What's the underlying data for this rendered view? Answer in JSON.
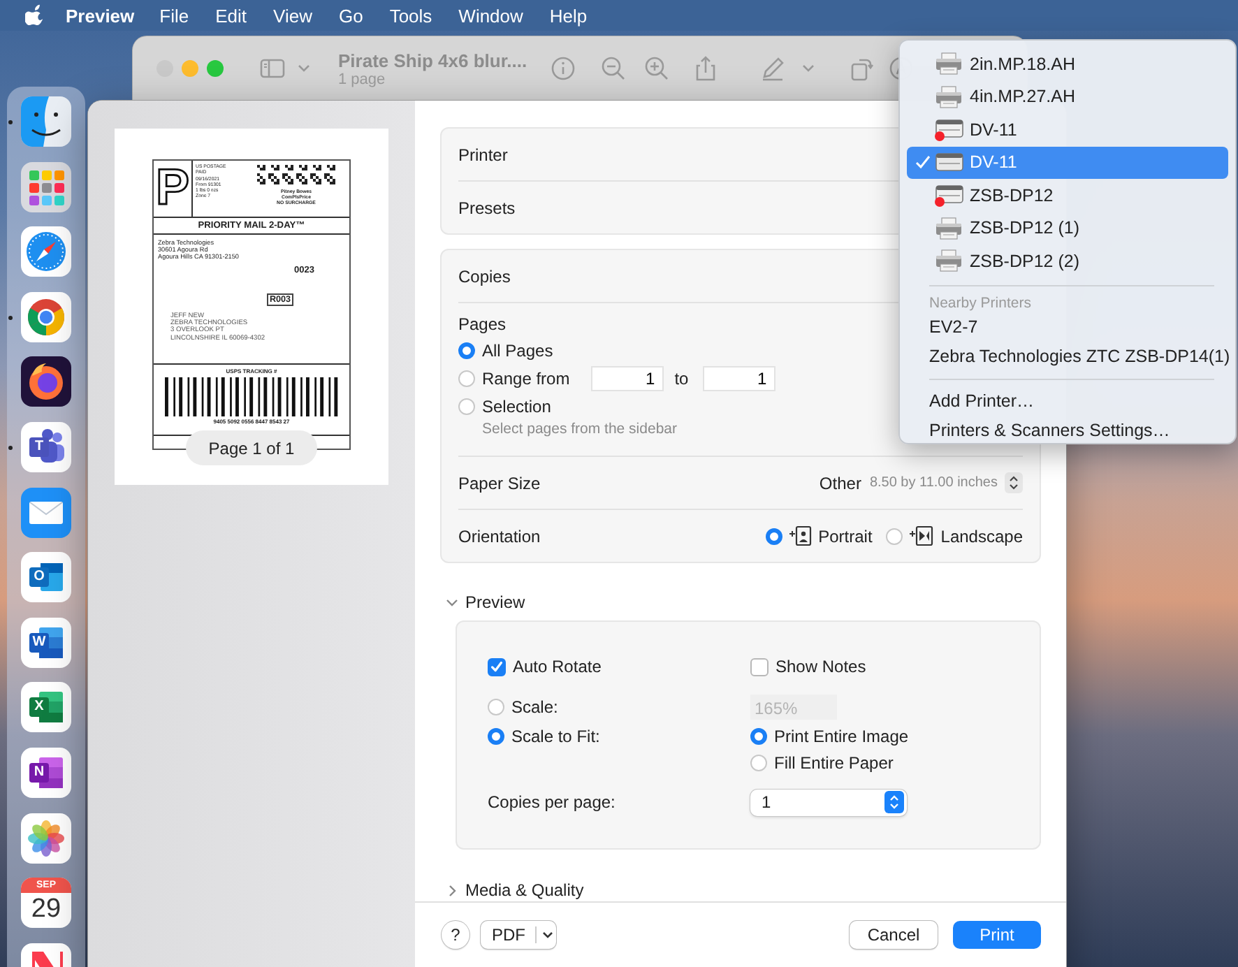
{
  "menubar": {
    "app": "Preview",
    "items": [
      "File",
      "Edit",
      "View",
      "Go",
      "Tools",
      "Window",
      "Help"
    ]
  },
  "preview_window": {
    "title": "Pirate Ship 4x6 blur....",
    "subtitle": "1 page"
  },
  "dock": {
    "apps": [
      {
        "kind": "finder",
        "running": true
      },
      {
        "kind": "launchpad",
        "running": false
      },
      {
        "kind": "safari",
        "running": false
      },
      {
        "kind": "chrome",
        "running": true
      },
      {
        "kind": "firefox",
        "running": false
      },
      {
        "kind": "teams",
        "running": true,
        "letter": "T"
      },
      {
        "kind": "mail",
        "running": false
      },
      {
        "kind": "outlook",
        "running": false,
        "letter": "O"
      },
      {
        "kind": "word",
        "running": false,
        "letter": "W"
      },
      {
        "kind": "excel",
        "running": false,
        "letter": "X"
      },
      {
        "kind": "onenote",
        "running": false,
        "letter": "N"
      },
      {
        "kind": "photos",
        "running": false
      },
      {
        "kind": "calendar",
        "running": false,
        "month": "SEP",
        "day": "29"
      },
      {
        "kind": "news",
        "running": false
      }
    ]
  },
  "print_sheet": {
    "thumbnail": {
      "page_indicator": "Page 1 of 1",
      "label": {
        "postage_mark": "P",
        "postage_lines": [
          "US POSTAGE",
          "PAID",
          "09/16/2021",
          "From 91301",
          "1 lbs 0 ozs",
          "Zone 7"
        ],
        "carrier_lines": [
          "Pitney Bowes",
          "ComPlsPrice",
          "NO SURCHARGE"
        ],
        "service": "PRIORITY MAIL 2-DAY™",
        "sender_lines": [
          "Zebra Technologies",
          "30601 Agoura Rd",
          "Agoura Hills CA 91301-2150"
        ],
        "route": "0023",
        "zone_code": "R003",
        "recipient_lines": [
          "JEFF NEW",
          "ZEBRA TECHNOLOGIES",
          "3 OVERLOOK PT",
          "LINCOLNSHIRE IL 60069-4302"
        ],
        "tracking_heading": "USPS TRACKING #",
        "tracking_number": "9405 5092 0556 8447 8543 27"
      }
    },
    "printer_label": "Printer",
    "presets_label": "Presets",
    "copies_label": "Copies",
    "pages": {
      "label": "Pages",
      "options": [
        {
          "label": "All Pages",
          "selected": true
        },
        {
          "label": "Range from",
          "selected": false
        },
        {
          "label": "Selection",
          "selected": false
        }
      ],
      "range_from": "1",
      "range_to_label": "to",
      "range_to": "1",
      "selection_hint": "Select pages from the sidebar"
    },
    "paper_size": {
      "label": "Paper Size",
      "value": "Other",
      "detail": "8.50 by 11.00 inches"
    },
    "orientation": {
      "label": "Orientation",
      "options": [
        {
          "label": "Portrait",
          "kind": "portrait",
          "selected": true
        },
        {
          "label": "Landscape",
          "kind": "landscape",
          "selected": false
        }
      ]
    },
    "preview_section": {
      "title": "Preview",
      "expanded": true,
      "auto_rotate": {
        "label": "Auto Rotate",
        "checked": true
      },
      "show_notes": {
        "label": "Show Notes",
        "checked": false
      },
      "scale_options": [
        {
          "label": "Scale:",
          "selected": false
        },
        {
          "label": "Scale to Fit:",
          "selected": true
        }
      ],
      "scale_field": {
        "value": "165%",
        "disabled": true
      },
      "fit_options": [
        {
          "label": "Print Entire Image",
          "selected": true
        },
        {
          "label": "Fill Entire Paper",
          "selected": false
        }
      ],
      "copies_per_page": {
        "label": "Copies per page:",
        "value": "1"
      }
    },
    "media_section": {
      "title": "Media & Quality",
      "expanded": false
    },
    "footer": {
      "help": "?",
      "pdf": "PDF",
      "cancel": "Cancel",
      "print": "Print"
    }
  },
  "printer_menu": {
    "printers": [
      {
        "name": "2in.MP.18.AH",
        "kind": "desktop",
        "error": false,
        "selected": false
      },
      {
        "name": "4in.MP.27.AH",
        "kind": "desktop",
        "error": false,
        "selected": false
      },
      {
        "name": "DV-11",
        "kind": "label",
        "error": true,
        "selected": false
      },
      {
        "name": "DV-11",
        "kind": "label",
        "error": false,
        "selected": true
      },
      {
        "name": "ZSB-DP12",
        "kind": "label",
        "error": true,
        "selected": false
      },
      {
        "name": "ZSB-DP12 (1)",
        "kind": "desktop",
        "error": false,
        "selected": false
      },
      {
        "name": "ZSB-DP12 (2)",
        "kind": "desktop",
        "error": false,
        "selected": false
      }
    ],
    "nearby_heading": "Nearby Printers",
    "nearby": [
      "EV2-7",
      "Zebra Technologies ZTC ZSB-DP14(1)"
    ],
    "actions": [
      "Add Printer…",
      "Printers & Scanners Settings…"
    ]
  }
}
